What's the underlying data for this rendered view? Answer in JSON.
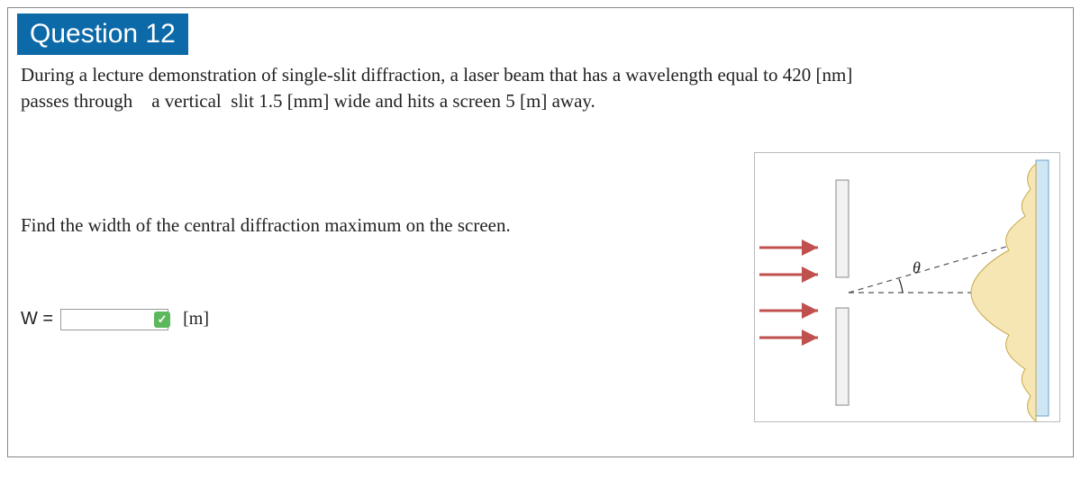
{
  "question": {
    "badge": "Question 12",
    "problem_line1": "During a lecture demonstration of single-slit diffraction, a laser beam that has a wavelength equal to 420 [nm]",
    "problem_line2": "passes through    a vertical  slit 1.5 [mm] wide and hits a screen 5 [m] away.",
    "find": "Find the width of the central diffraction maximum on the screen.",
    "answer_label": "W =",
    "answer_value": "",
    "unit": "[m]"
  },
  "diagram": {
    "theta_label": "θ"
  }
}
